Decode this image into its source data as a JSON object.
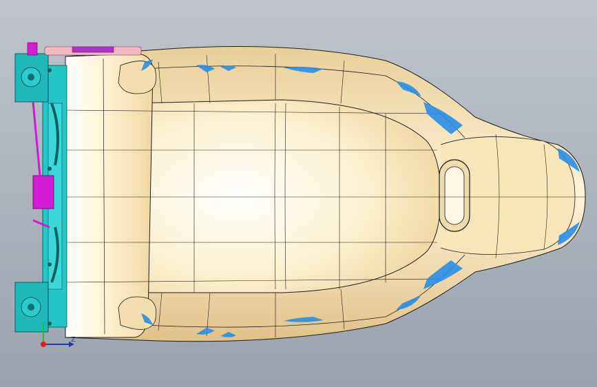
{
  "viewport": {
    "background_top": "#bfc4cb",
    "background_bottom": "#9aa3ae"
  },
  "model": {
    "shell_color": "#f2ddb0",
    "shell_highlight": "#fff6dc",
    "edge_color": "#1c1c1c",
    "wear_color": "#2a8ee8",
    "frame_color": "#22c6c6",
    "bracket_color": "#d21bd2"
  },
  "triad": {
    "x_label": "",
    "z_label": "Z",
    "x_color": "#e41a1a",
    "y_color": "#20c020",
    "z_color": "#1f3aa6",
    "icons": [
      "axis-triad-icon"
    ]
  }
}
